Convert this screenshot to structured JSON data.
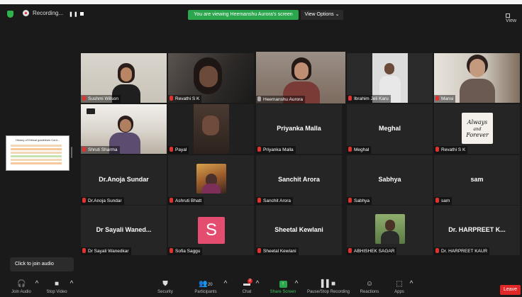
{
  "top": {
    "recording_label": "Recording...",
    "pause_glyph": "❚❚",
    "viewing_banner": "You are viewing Heemanshu Aurora's screen",
    "view_options": "View Options ⌄",
    "view_label": "View"
  },
  "shared_screen": {
    "title": "History of Ethical guidelines Cont..."
  },
  "tiles": [
    {
      "name": "Sushmi Wilson",
      "video": true
    },
    {
      "name": "Revathi S K",
      "video": true
    },
    {
      "name": "Heemanshu Aurora",
      "video": true,
      "active": true
    },
    {
      "name": "Ibrahim Jeli Karu",
      "video": true
    },
    {
      "name": "Mansi",
      "video": true
    },
    {
      "name": "Shruti Sharma",
      "video": true
    },
    {
      "name": "Payal",
      "video": true
    },
    {
      "name": "Priyanka Malla",
      "center": "Priyanka  Malla"
    },
    {
      "name": "Meghal",
      "center": "Meghal"
    },
    {
      "name": "Revathi S K",
      "picture": "Always and Forever"
    },
    {
      "name": "Dr.Anoja Sundar",
      "center": "Dr.Anoja Sundar"
    },
    {
      "name": "Ashruti Bhatt",
      "picture": "photo"
    },
    {
      "name": "Sanchit Arora",
      "center": "Sanchit Arora"
    },
    {
      "name": "Sabhya",
      "center": "Sabhya"
    },
    {
      "name": "sam",
      "center": "sam"
    },
    {
      "name": "Dr Sayali Wanedkar",
      "center": "Dr Sayali Waned..."
    },
    {
      "name": "Sofia Saggu",
      "picture": "S"
    },
    {
      "name": "Sheetal Kewlani",
      "center": "Sheetal Kewlani"
    },
    {
      "name": "ABHISHEK SAGAR",
      "picture": "photo"
    },
    {
      "name": "Dr. HARPREET KAUR",
      "center": "Dr. HARPREET K..."
    }
  ],
  "tooltip": "Click to join audio",
  "toolbar": {
    "join_audio": "Join Audio",
    "stop_video": "Stop Video",
    "security": "Security",
    "participants": "Participants",
    "participants_count": "20",
    "chat": "Chat",
    "chat_badge": "2",
    "share_screen": "Share Screen",
    "pause_stop_recording": "Pause/Stop Recording",
    "reactions": "Reactions",
    "apps": "Apps",
    "leave": "Leave"
  },
  "colors": {
    "active_border": "#9fd22b",
    "banner_green": "#2ca64c",
    "leave_red": "#e02828",
    "mic_muted": "#e0332f"
  }
}
